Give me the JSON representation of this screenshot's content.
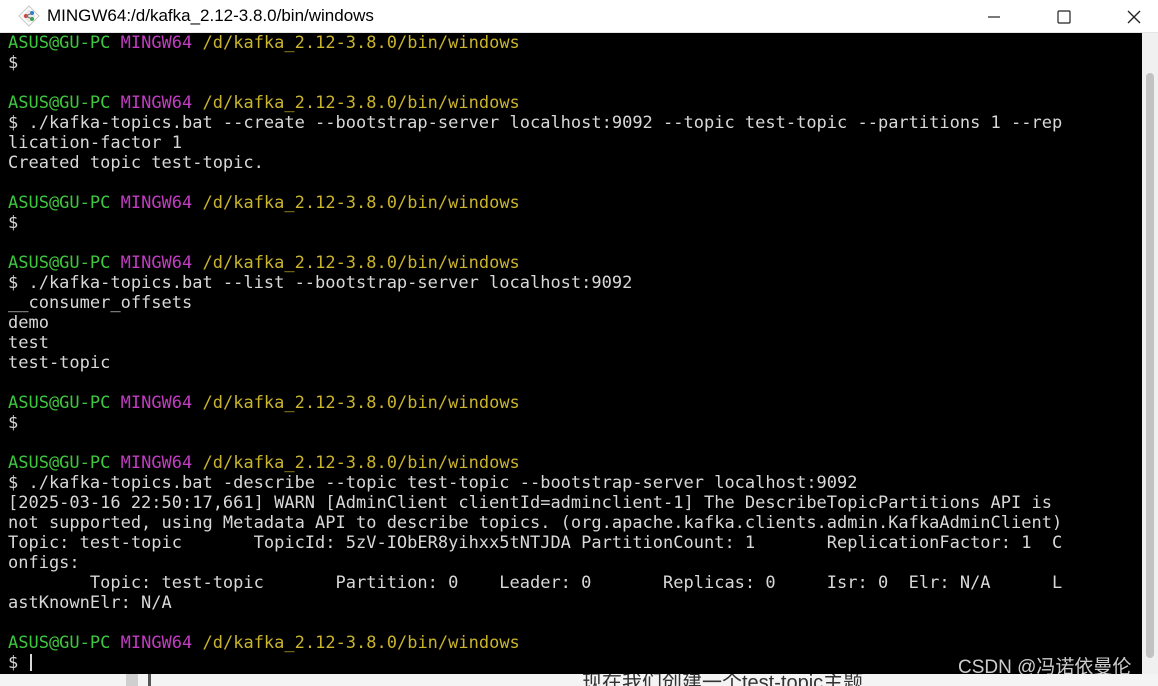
{
  "window": {
    "title": "MINGW64:/d/kafka_2.12-3.8.0/bin/windows",
    "icon": "git-bash-icon",
    "controls": [
      "minimize-icon",
      "maximize-icon",
      "close-icon"
    ]
  },
  "colors": {
    "terminal_bg": "#000000",
    "text": "#d8d8d8",
    "prompt_user": "#3ec63e",
    "prompt_host": "#c23cc2",
    "prompt_path": "#c9b42c"
  },
  "prompt": {
    "user": "ASUS@GU-PC",
    "host": "MINGW64",
    "path": "/d/kafka_2.12-3.8.0/bin/windows"
  },
  "terminal": {
    "lines": [
      {
        "type": "prompt"
      },
      {
        "type": "text",
        "text": "$"
      },
      {
        "type": "text",
        "text": ""
      },
      {
        "type": "prompt"
      },
      {
        "type": "text",
        "text": "$ ./kafka-topics.bat --create --bootstrap-server localhost:9092 --topic test-topic --partitions 1 --rep"
      },
      {
        "type": "text",
        "text": "lication-factor 1"
      },
      {
        "type": "text",
        "text": "Created topic test-topic."
      },
      {
        "type": "text",
        "text": ""
      },
      {
        "type": "prompt"
      },
      {
        "type": "text",
        "text": "$"
      },
      {
        "type": "text",
        "text": ""
      },
      {
        "type": "prompt"
      },
      {
        "type": "text",
        "text": "$ ./kafka-topics.bat --list --bootstrap-server localhost:9092"
      },
      {
        "type": "text",
        "text": "__consumer_offsets"
      },
      {
        "type": "text",
        "text": "demo"
      },
      {
        "type": "text",
        "text": "test"
      },
      {
        "type": "text",
        "text": "test-topic"
      },
      {
        "type": "text",
        "text": ""
      },
      {
        "type": "prompt"
      },
      {
        "type": "text",
        "text": "$"
      },
      {
        "type": "text",
        "text": ""
      },
      {
        "type": "prompt"
      },
      {
        "type": "text",
        "text": "$ ./kafka-topics.bat -describe --topic test-topic --bootstrap-server localhost:9092"
      },
      {
        "type": "text",
        "text": "[2025-03-16 22:50:17,661] WARN [AdminClient clientId=adminclient-1] The DescribeTopicPartitions API is"
      },
      {
        "type": "text",
        "text": "not supported, using Metadata API to describe topics. (org.apache.kafka.clients.admin.KafkaAdminClient)"
      },
      {
        "type": "text",
        "text": "Topic: test-topic       TopicId: 5zV-IObER8yihxx5tNTJDA PartitionCount: 1       ReplicationFactor: 1  C"
      },
      {
        "type": "text",
        "text": "onfigs:"
      },
      {
        "type": "text",
        "text": "        Topic: test-topic       Partition: 0    Leader: 0       Replicas: 0     Isr: 0  Elr: N/A      L"
      },
      {
        "type": "text",
        "text": "astKnownElr: N/A"
      },
      {
        "type": "text",
        "text": ""
      },
      {
        "type": "prompt"
      },
      {
        "type": "text",
        "text": "$ ",
        "cursor": true
      }
    ]
  },
  "background_page": {
    "partial_text": "现在我们创建一个test-topic主题"
  },
  "watermark": "CSDN @冯诺依曼伦"
}
